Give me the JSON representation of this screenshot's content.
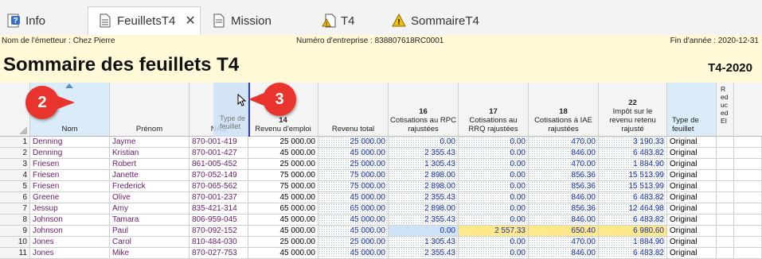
{
  "tabs": [
    {
      "label": "Info",
      "icon": "help-doc-icon"
    },
    {
      "label": "FeuilletsT4",
      "icon": "document-icon",
      "close": "✕"
    },
    {
      "label": "Mission",
      "icon": "document-icon"
    },
    {
      "label": "T4",
      "icon": "warning-doc-icon"
    },
    {
      "label": "SommaireT4",
      "icon": "warning-icon"
    }
  ],
  "header": {
    "issuer": "Nom de l'émetteur : Chez Pierre",
    "business_number": "Numéro d'entreprise : 838807618RC0001",
    "year_end": "Fin d'année : 2020-12-31",
    "title": "Sommaire des feuillets T4",
    "form_code": "T4-2020"
  },
  "columns": {
    "nom": "Nom",
    "prenom": "Prénom",
    "nas": "NAS",
    "type_tooltip": "Type de\nfeuillet",
    "c14_num": "14",
    "c14": "Revenu d'emploi",
    "total": "Revenu total",
    "c16_num": "16",
    "c16": "Cotisations au RPC rajustées",
    "c17_num": "17",
    "c17": "Cotisations au RRQ rajustées",
    "c18_num": "18",
    "c18": "Cotisations à IAE rajustées",
    "c22_num": "22",
    "c22": "Impôt sur le revenu retenu rajusté",
    "type": "Type de feuillet",
    "last": "R\ned\nuc\ned\nEI"
  },
  "rows": [
    {
      "n": "1",
      "nom": "Denning",
      "prenom": "Jayme",
      "nas": "870-001-419",
      "c14": "25 000.00",
      "total": "25 000.00",
      "c16": "0.00",
      "c17": "0.00",
      "c18": "470.00",
      "c22": "3 190.33",
      "type": "Original"
    },
    {
      "n": "2",
      "nom": "Denning",
      "prenom": "Kristian",
      "nas": "870-001-427",
      "c14": "45 000.00",
      "total": "45 000.00",
      "c16": "2 355.43",
      "c17": "0.00",
      "c18": "846.00",
      "c22": "6 483.82",
      "type": "Original"
    },
    {
      "n": "3",
      "nom": "Friesen",
      "prenom": "Robert",
      "nas": "861-005-452",
      "c14": "25 000.00",
      "total": "25 000.00",
      "c16": "1 305.43",
      "c17": "0.00",
      "c18": "470.00",
      "c22": "1 884.90",
      "type": "Original"
    },
    {
      "n": "4",
      "nom": "Friesen",
      "prenom": "Janette",
      "nas": "870-052-149",
      "c14": "75 000.00",
      "total": "75 000.00",
      "c16": "2 898.00",
      "c17": "0.00",
      "c18": "856.36",
      "c22": "15 513.99",
      "type": "Original"
    },
    {
      "n": "5",
      "nom": "Friesen",
      "prenom": "Frederick",
      "nas": "870-065-562",
      "c14": "75 000.00",
      "total": "75 000.00",
      "c16": "2 898.00",
      "c17": "0.00",
      "c18": "856.36",
      "c22": "15 513.99",
      "type": "Original"
    },
    {
      "n": "6",
      "nom": "Greene",
      "prenom": "Olive",
      "nas": "870-001-237",
      "c14": "45 000.00",
      "total": "45 000.00",
      "c16": "2 355.43",
      "c17": "0.00",
      "c18": "846.00",
      "c22": "6 483.82",
      "type": "Original"
    },
    {
      "n": "7",
      "nom": "Jessup",
      "prenom": "Amy",
      "nas": "835-421-314",
      "c14": "65 000.00",
      "total": "65 000.00",
      "c16": "2 898.00",
      "c17": "0.00",
      "c18": "856.36",
      "c22": "12 464.98",
      "type": "Original"
    },
    {
      "n": "8",
      "nom": "Johnson",
      "prenom": "Tamara",
      "nas": "806-959-045",
      "c14": "45 000.00",
      "total": "45 000.00",
      "c16": "2 355.43",
      "c17": "0.00",
      "c18": "846.00",
      "c22": "6 483.82",
      "type": "Original"
    },
    {
      "n": "9",
      "nom": "Johnson",
      "prenom": "Paul",
      "nas": "870-092-152",
      "c14": "45 000.00",
      "total": "45 000.00",
      "c16": "0.00",
      "c17": "2 557.33",
      "c18": "650.40",
      "c22": "6 980.60",
      "type": "Original",
      "highlight": true
    },
    {
      "n": "10",
      "nom": "Jones",
      "prenom": "Carol",
      "nas": "810-484-030",
      "c14": "25 000.00",
      "total": "25 000.00",
      "c16": "1 305.43",
      "c17": "0.00",
      "c18": "470.00",
      "c22": "1 884.90",
      "type": "Original"
    },
    {
      "n": "11",
      "nom": "Jones",
      "prenom": "Mike",
      "nas": "870-027-753",
      "c14": "45 000.00",
      "total": "45 000.00",
      "c16": "2 355.43",
      "c17": "0.00",
      "c18": "846.00",
      "c22": "6 483.82",
      "type": "Original"
    }
  ],
  "callouts": [
    "2",
    "3"
  ],
  "colors": {
    "accent_red": "#e8342c",
    "info_band": "#fff9d8",
    "highlight": "#fde98a"
  }
}
